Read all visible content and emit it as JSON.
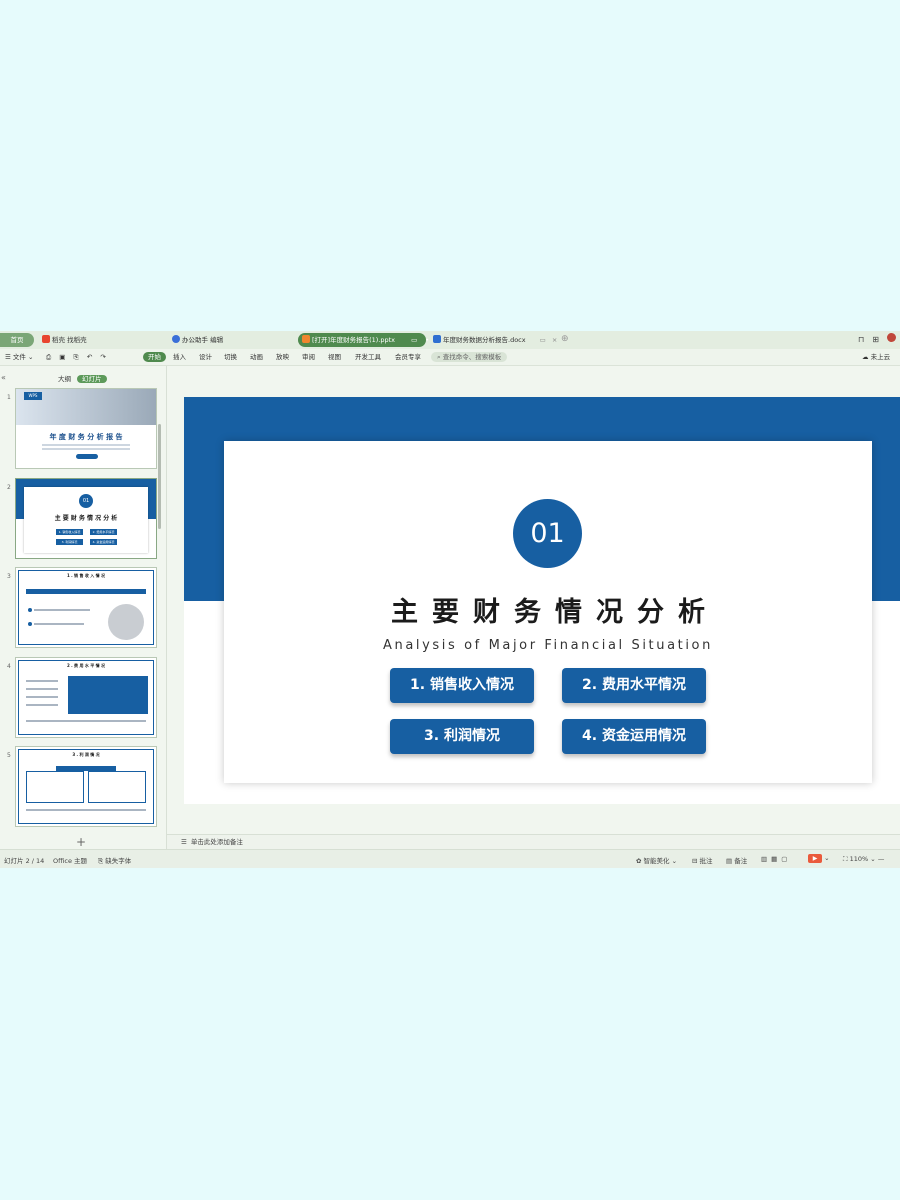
{
  "tabs": [
    {
      "label": "首页"
    },
    {
      "label": "稻壳 找稻壳"
    },
    {
      "label": "办公助手 编辑"
    },
    {
      "label": "[打开]年度财务报告(1).pptx"
    },
    {
      "label": "年度财务数据分析报告.docx"
    }
  ],
  "ribbon": {
    "file_menu": "☰ 文件 ⌄",
    "items": [
      "开始",
      "插入",
      "设计",
      "切换",
      "动画",
      "放映",
      "审阅",
      "视图",
      "开发工具",
      "会员专享"
    ],
    "search_placeholder": "⌕ 查找命令、搜索模板",
    "cloud": "未上云"
  },
  "left_panel": {
    "tab_outline": "大纲",
    "tab_slides": "幻灯片",
    "slides": [
      {
        "num": "1",
        "title": "年 度 财 务 分 析 报 告",
        "tag": "WPS"
      },
      {
        "num": "2",
        "badge": "01",
        "title": "主 要 财 务 情 况 分 析",
        "items": [
          "1. 销售收入情况",
          "2. 费用水平情况",
          "3. 利润情况",
          "4. 资金运用情况"
        ]
      },
      {
        "num": "3",
        "title": "1 . 销 售 收 入 情 况"
      },
      {
        "num": "4",
        "title": "2 . 费 用 水 平 情 况"
      },
      {
        "num": "5",
        "title": "3 . 利 润 情 况"
      }
    ],
    "add_slide": "+"
  },
  "slide": {
    "number_badge": "01",
    "title": "主要财务情况分析",
    "subtitle": "Analysis of Major Financial Situation",
    "buttons": [
      "1. 销售收入情况",
      "2. 费用水平情况",
      "3. 利润情况",
      "4. 资金运用情况"
    ]
  },
  "notes_placeholder": "单击此处添加备注",
  "status": {
    "slide_counter": "幻灯片 2 / 14",
    "theme": "Office 主题",
    "missing_font": "缺失字体",
    "smart_beautify": "智能美化",
    "comments": "批注",
    "notes": "备注",
    "zoom": "110%"
  },
  "colors": {
    "slide_blue": "#175fa2",
    "window_green": "#4f8a4e",
    "background": "#e6fbfc"
  }
}
